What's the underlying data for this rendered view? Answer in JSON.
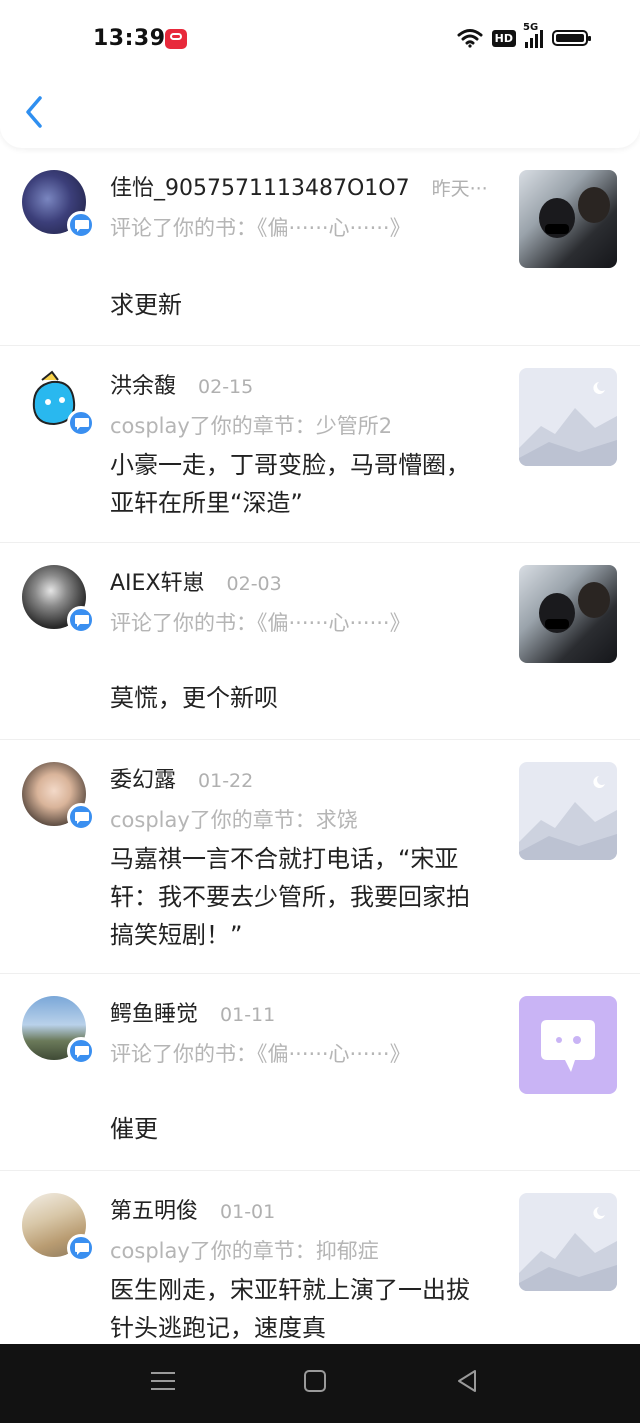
{
  "status_bar": {
    "time": "13:39",
    "hd": "HD",
    "network": "5G"
  },
  "items": [
    {
      "name": "佳怡_9057571113487O1O7",
      "date": "昨天···",
      "action": "评论了你的书：《偏······心······》",
      "content": "求更新"
    },
    {
      "name": "洪余馥",
      "date": "02-15",
      "action": "cosplay了你的章节：少管所2",
      "content": "小豪一走，丁哥变脸，马哥懵圈，亚轩在所里“深造”"
    },
    {
      "name": "AIEX轩崽",
      "date": "02-03",
      "action": "评论了你的书：《偏······心······》",
      "content": "莫慌，更个新呗"
    },
    {
      "name": "委幻露",
      "date": "01-22",
      "action": "cosplay了你的章节：求饶",
      "content": "马嘉祺一言不合就打电话，“宋亚轩：我不要去少管所，我要回家拍搞笑短剧！”"
    },
    {
      "name": "鳄鱼睡觉",
      "date": "01-11",
      "action": "评论了你的书：《偏······心······》",
      "content": "催更"
    },
    {
      "name": "第五明俊",
      "date": "01-01",
      "action": "cosplay了你的章节：抑郁症",
      "content": "医生刚走，宋亚轩就上演了一出拔针头逃跑记，速度真"
    }
  ]
}
